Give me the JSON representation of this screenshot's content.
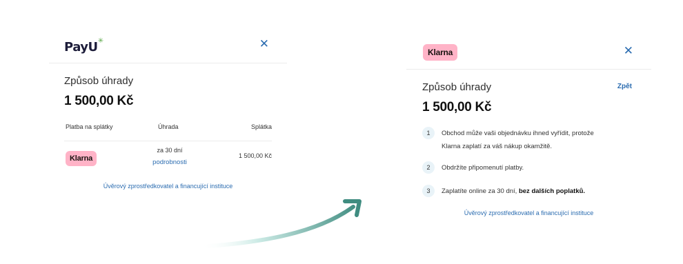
{
  "left_panel": {
    "logo_text_main": "Pay",
    "logo_text_u": "U",
    "logo_spark": "✳",
    "close_symbol": "✕",
    "title": "Způsob úhrady",
    "amount": "1 500,00 Kč",
    "table_headers": [
      "Platba na splátky",
      "Úhrada",
      "Splátka"
    ],
    "row": {
      "provider": "Klarna",
      "term": "za 30 dní",
      "details_link": "podrobnosti",
      "amount": "1 500,00 Kč"
    },
    "footer_link": "Úvěrový zprostředkovatel a financující instituce"
  },
  "right_panel": {
    "brand": "Klarna",
    "close_symbol": "✕",
    "title": "Způsob úhrady",
    "back_link": "Zpět",
    "amount": "1 500,00 Kč",
    "steps": [
      {
        "num": "1",
        "text_line1": "Obchod může vaši objednávku ihned vyřídit, protože",
        "text_line2": "Klarna zaplatí za váš nákup okamžitě."
      },
      {
        "num": "2",
        "text": "Obdržíte připomenutí platby."
      },
      {
        "num": "3",
        "text_plain": "Zaplatíte online za 30 dní, ",
        "text_bold": "bez dalších poplatků."
      }
    ],
    "footer_link": "Úvěrový zprostředkovatel a financující instituce"
  },
  "colors": {
    "klarna_pink": "#ffb3c7",
    "link_blue": "#2b6cb0",
    "arrow_teal": "#4a9a8c"
  }
}
